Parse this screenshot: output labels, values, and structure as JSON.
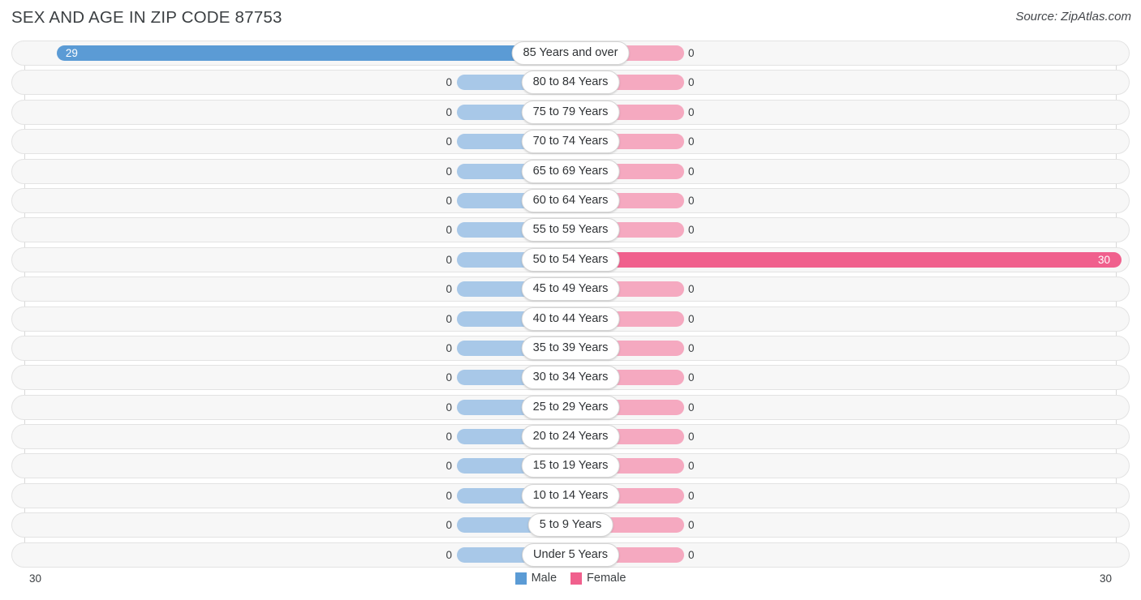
{
  "header": {
    "title": "SEX AND AGE IN ZIP CODE 87753",
    "source": "Source: ZipAtlas.com"
  },
  "legend": {
    "male_label": "Male",
    "female_label": "Female",
    "male_color": "#5b9bd5",
    "female_color": "#f0608d"
  },
  "axis": {
    "left_label": "30",
    "right_label": "30"
  },
  "chart_data": {
    "type": "bar",
    "orientation": "horizontal",
    "style": "population-pyramid",
    "title": "SEX AND AGE IN ZIP CODE 87753",
    "xlabel": "",
    "ylabel": "",
    "xlim": [
      30,
      30
    ],
    "grid": false,
    "legend_position": "bottom-center",
    "categories": [
      "85 Years and over",
      "80 to 84 Years",
      "75 to 79 Years",
      "70 to 74 Years",
      "65 to 69 Years",
      "60 to 64 Years",
      "55 to 59 Years",
      "50 to 54 Years",
      "45 to 49 Years",
      "40 to 44 Years",
      "35 to 39 Years",
      "30 to 34 Years",
      "25 to 29 Years",
      "20 to 24 Years",
      "15 to 19 Years",
      "10 to 14 Years",
      "5 to 9 Years",
      "Under 5 Years"
    ],
    "series": [
      {
        "name": "Male",
        "color": "#5b9bd5",
        "values": [
          29,
          0,
          0,
          0,
          0,
          0,
          0,
          0,
          0,
          0,
          0,
          0,
          0,
          0,
          0,
          0,
          0,
          0
        ]
      },
      {
        "name": "Female",
        "color": "#f0608d",
        "values": [
          0,
          0,
          0,
          0,
          0,
          0,
          0,
          30,
          0,
          0,
          0,
          0,
          0,
          0,
          0,
          0,
          0,
          0
        ]
      }
    ]
  }
}
